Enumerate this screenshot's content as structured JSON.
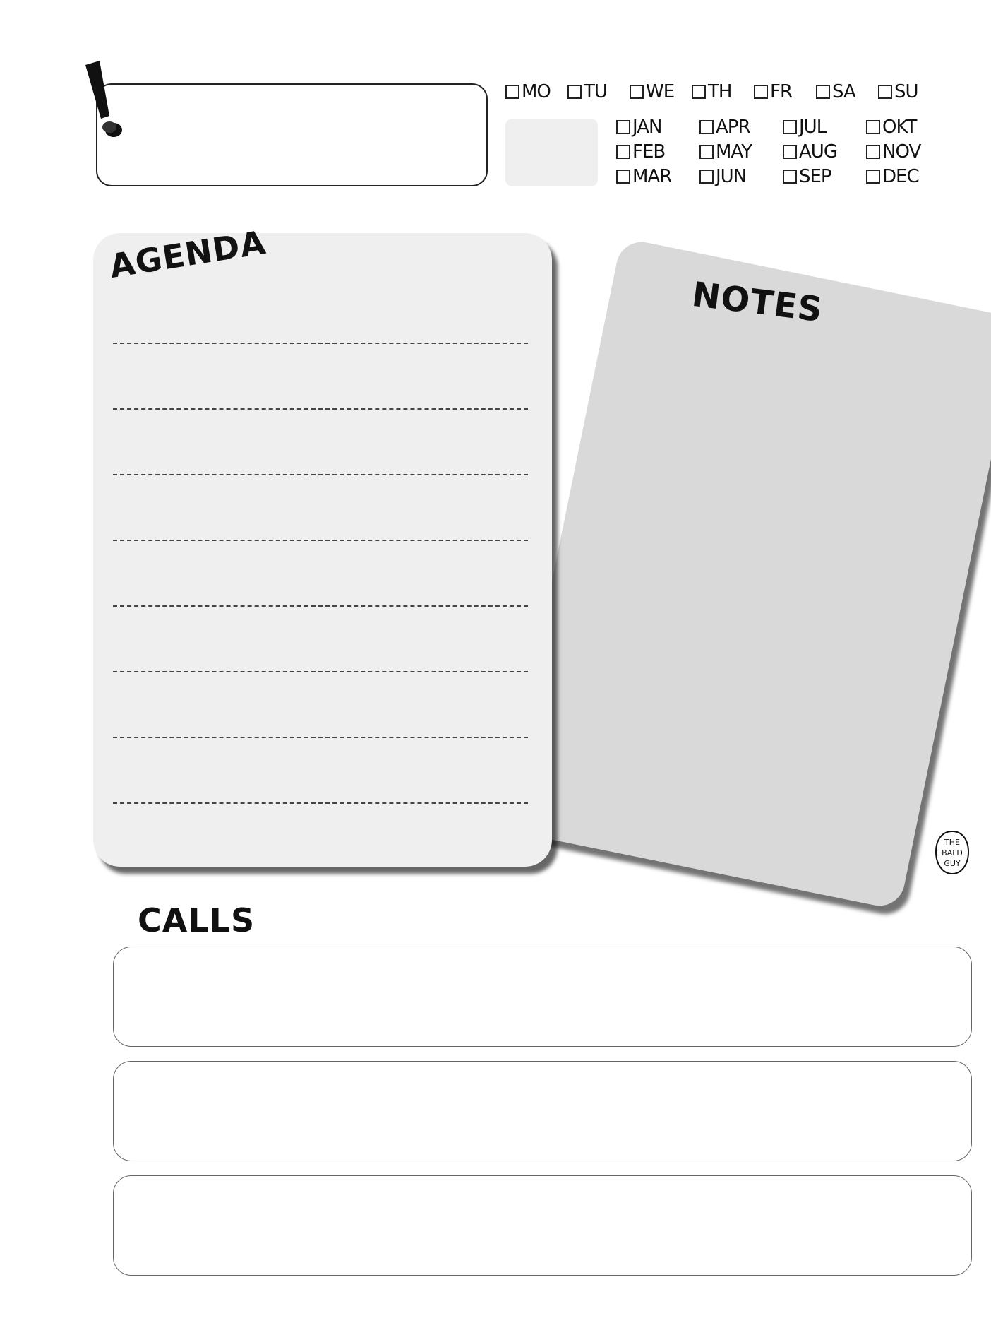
{
  "days": [
    "MO",
    "TU",
    "WE",
    "TH",
    "FR",
    "SA",
    "SU"
  ],
  "months": [
    [
      "JAN",
      "FEB",
      "MAR"
    ],
    [
      "APR",
      "MAY",
      "JUN"
    ],
    [
      "JUL",
      "AUG",
      "SEP"
    ],
    [
      "OKT",
      "NOV",
      "DEC"
    ]
  ],
  "agenda": {
    "title": "AGENDA",
    "line_count": 8
  },
  "notes": {
    "title": "NOTES"
  },
  "calls": {
    "title": "CALLS",
    "box_count": 3
  },
  "logo": {
    "text": "THE BALD GUY"
  },
  "colors": {
    "agenda_card": "#efefef",
    "notes_card": "#d9d9d9",
    "date_box": "#efefef",
    "ink": "#111111"
  }
}
